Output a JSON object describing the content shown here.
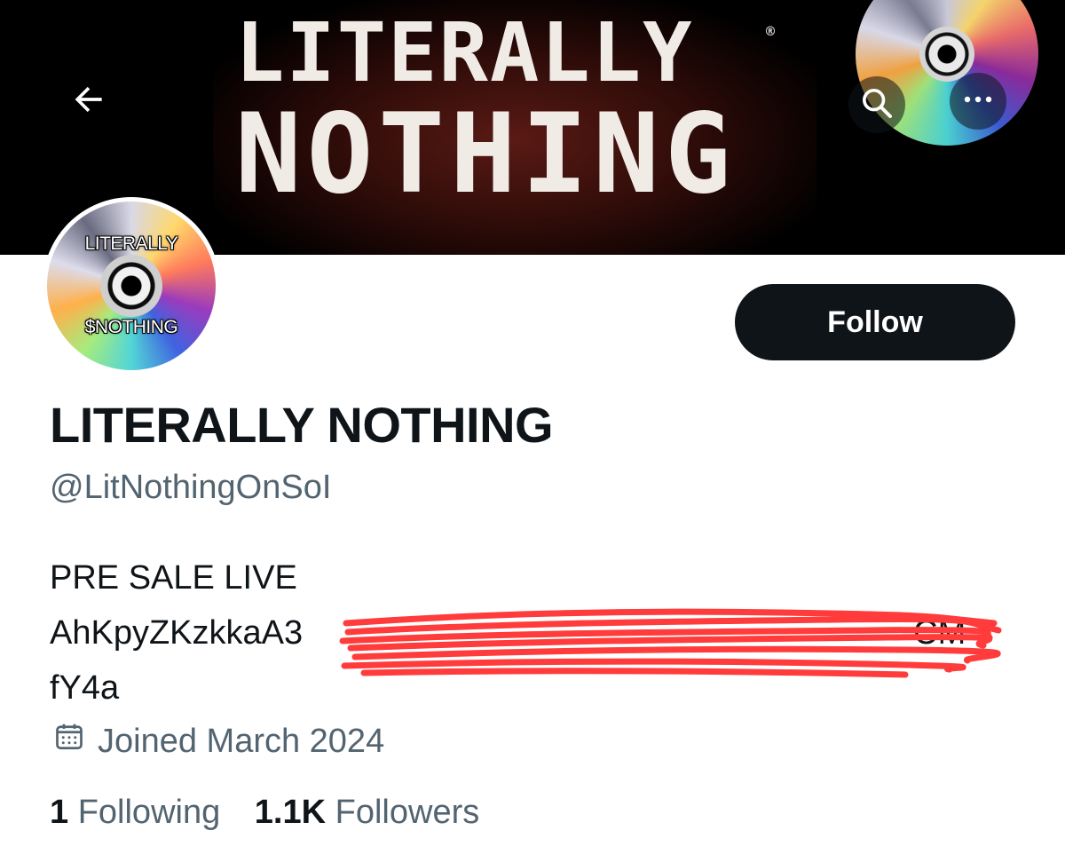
{
  "header": {
    "banner_line1": "LITERALLY",
    "banner_line2": "NOTHING",
    "banner_reg": "®",
    "back_icon": "arrow-left-icon",
    "search_icon": "search-icon",
    "more_icon": "more-horizontal-icon"
  },
  "profile": {
    "avatar_text_top": "LITERALLY",
    "avatar_text_bottom": "$NOTHING",
    "follow_label": "Follow",
    "display_name": "LITERALLY NOTHING",
    "handle": "@LitNothingOnSoI",
    "bio_line1": "PRE SALE LIVE",
    "bio_line2_visible": "AhKpyZKzkkaA3",
    "bio_line2_end": "CM",
    "bio_line3": "fY4a",
    "joined_text": "Joined March 2024",
    "following_count": "1",
    "following_label": "Following",
    "followers_count": "1.1K",
    "followers_label": "Followers"
  },
  "colors": {
    "primary_text": "#0f1419",
    "secondary_text": "#536471",
    "follow_bg": "#0f1419",
    "redaction": "#ff3b3b"
  }
}
